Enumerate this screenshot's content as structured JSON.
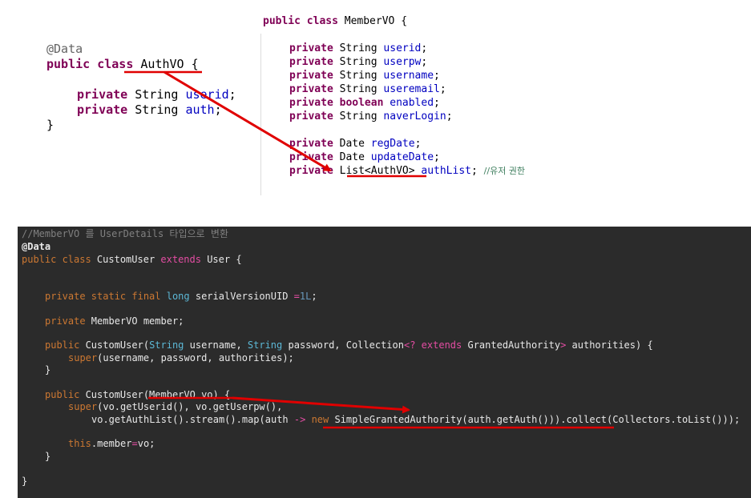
{
  "authvo": {
    "annotation": "@Data",
    "decl_kw": "public class",
    "decl_name": " AuthVO {",
    "fields": [
      {
        "kw": "private",
        "type": " String ",
        "name": "userid",
        "end": ";"
      },
      {
        "kw": "private",
        "type": " String ",
        "name": "auth",
        "end": ";"
      }
    ],
    "close": "}"
  },
  "membervo": {
    "decl_kw": "public class",
    "decl_name": " MemberVO {",
    "fields": [
      {
        "kw": "private",
        "type": " String ",
        "name": "userid",
        "end": ";"
      },
      {
        "kw": "private",
        "type": " String ",
        "name": "userpw",
        "end": ";"
      },
      {
        "kw": "private",
        "type": " String ",
        "name": "username",
        "end": ";"
      },
      {
        "kw": "private",
        "type": " String ",
        "name": "useremail",
        "end": ";"
      },
      {
        "kw": "private",
        "type": " ",
        "type_kw": "boolean",
        "type2": " ",
        "name": "enabled",
        "end": ";"
      },
      {
        "kw": "private",
        "type": " String ",
        "name": "naverLogin",
        "end": ";"
      },
      {
        "kw": "private",
        "type": " Date ",
        "name": "regDate",
        "end": ";"
      },
      {
        "kw": "private",
        "type": " Date ",
        "name": "updateDate",
        "end": ";"
      },
      {
        "kw": "private",
        "type": " List<AuthVO> ",
        "name": "authList",
        "end": "; ",
        "comment": "//유저 권한"
      }
    ]
  },
  "customuser": {
    "comment": "//MemberVO 를 UserDetails 타입으로 변환",
    "annotation": "@Data",
    "decl": {
      "kw": "public class",
      "name": " CustomUser ",
      "ext": "extends",
      "parent": " User {"
    },
    "serial": {
      "mods": "private static final ",
      "type": "long",
      "rest": " serialVersionUID ",
      "op": "=",
      "num": "1L",
      "end": ";"
    },
    "member": {
      "kw": "private",
      "rest": " MemberVO member;"
    },
    "ctor1": {
      "kw": "public",
      "name": " CustomUser(",
      "t1": "String",
      "r1": " username, ",
      "t2": "String",
      "r2": " password, Collection",
      "lt": "<? ",
      "ext": "extends",
      "r3": " GrantedAuthority",
      "gt": ">",
      "r4": " authorities) {",
      "super_kw": "super",
      "super_rest": "(username, password, authorities);",
      "close": "}"
    },
    "ctor2": {
      "kw": "public",
      "sig": " CustomUser(MemberVO vo) {",
      "super_kw": "super",
      "super_rest": "(vo.getUserid(), vo.getUserpw(),",
      "stream_a": "vo.getAuthList().stream().map(auth ",
      "arrow": "->",
      "sp": " ",
      "new_kw": "new",
      "stream_b": " SimpleGrantedAuthority(auth.getAuth())).collect(Collectors.toList()));",
      "this_kw": "this",
      "assign_a": ".member",
      "assign_op": "=",
      "assign_b": "vo;",
      "close": "}"
    },
    "close": "}"
  },
  "colors": {
    "arrow": "#e00000",
    "dark_bg": "#2b2b2b"
  }
}
